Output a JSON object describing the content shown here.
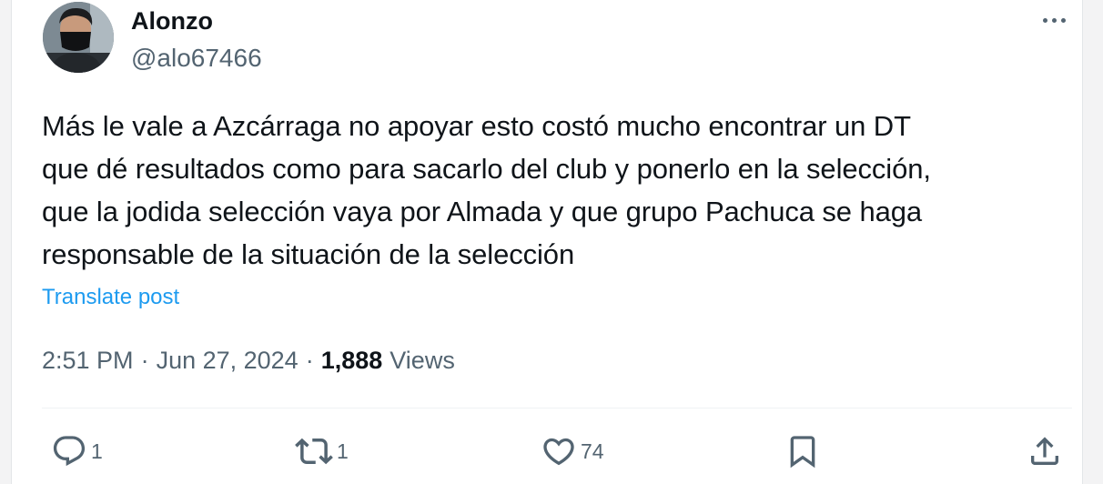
{
  "author": {
    "display_name": "Alonzo",
    "handle": "@alo67466",
    "avatar_icon": "user-avatar-photo"
  },
  "post": {
    "text_lines": [
      "Más le vale a Azcárraga no apoyar esto costó mucho encontrar un DT",
      "que dé resultados como para sacarlo del club y ponerlo en la selección,",
      "que la jodida selección vaya por Almada y que grupo Pachuca se haga",
      "responsable de la situación de la selección"
    ],
    "translate_label": "Translate post"
  },
  "meta": {
    "time": "2:51 PM",
    "separator": "·",
    "date": "Jun 27, 2024",
    "views_count": "1,888",
    "views_label": "Views"
  },
  "actions": {
    "reply": {
      "icon": "reply-icon",
      "count": "1"
    },
    "repost": {
      "icon": "repost-icon",
      "count": "1"
    },
    "like": {
      "icon": "heart-icon",
      "count": "74"
    },
    "bookmark": {
      "icon": "bookmark-icon"
    },
    "share": {
      "icon": "share-icon"
    }
  },
  "colors": {
    "text_primary": "#0f1419",
    "text_secondary": "#536471",
    "accent": "#1d9bf0",
    "divider": "#eff3f4"
  }
}
